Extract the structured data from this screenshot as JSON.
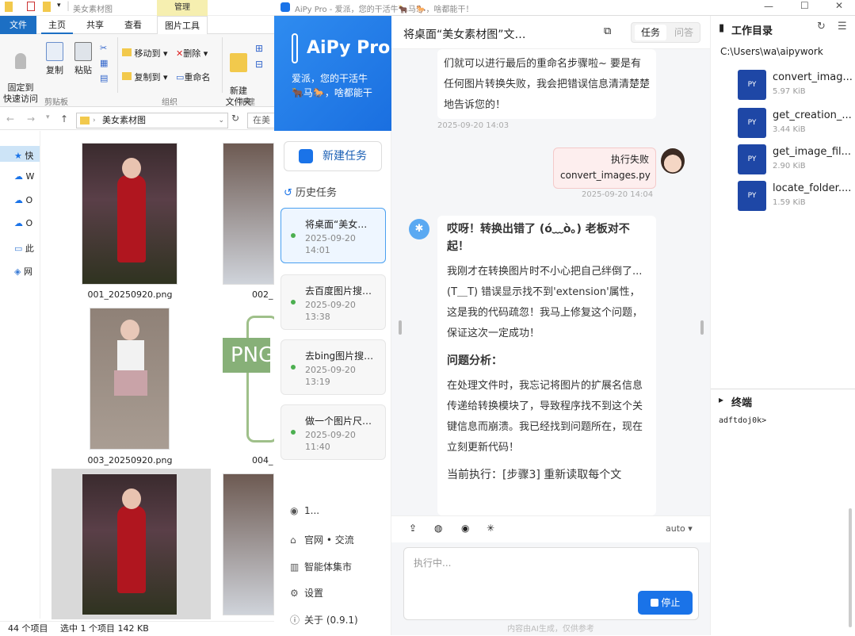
{
  "explorer": {
    "title": "美女素材图",
    "manage_tab": "管理",
    "tabs": [
      "文件",
      "主页",
      "共享",
      "查看",
      "图片工具"
    ],
    "ribbon": {
      "pin": "固定到\n快速访问",
      "copy": "复制",
      "paste": "粘贴",
      "move_to": "移动到",
      "copy_to": "复制到",
      "delete": "删除",
      "rename": "重命名",
      "new_folder": "新建\n文件夹",
      "group_clipboard": "剪贴板",
      "group_organize": "组织",
      "group_new": "新建"
    },
    "address": "美女素材图",
    "search_placeholder": "在美",
    "nav_items": [
      "快",
      "W",
      "O",
      "O",
      "此",
      "网"
    ],
    "files": [
      {
        "name": "001_20250920.png"
      },
      {
        "name": "002_"
      },
      {
        "name": "003_20250920.png"
      },
      {
        "name": "004_"
      }
    ],
    "status_count": "44 个项目",
    "status_selected": "选中 1 个项目  142 KB"
  },
  "aipy": {
    "window_title": "AiPy Pro - 爱派，您的干活牛🐂马🐎，啥都能干！",
    "app_name": "AiPy Pro",
    "slogan": "爱派，您的干活牛🐂马🐎，啥都能干",
    "new_task": "新建任务",
    "history": "历史任务",
    "tasks": [
      {
        "title": "将桌面“美女…",
        "date": "2025-09-20 14:01"
      },
      {
        "title": "去百度图片搜…",
        "date": "2025-09-20 13:38"
      },
      {
        "title": "去bing图片搜…",
        "date": "2025-09-20 13:19"
      },
      {
        "title": "做一个图片尺…",
        "date": "2025-09-20 11:40"
      }
    ],
    "bottom": {
      "user": "1...",
      "site": "官网 • 交流",
      "market": "智能体集市",
      "settings": "设置",
      "about": "关于 (0.9.1)"
    },
    "chat": {
      "title": "将桌面“美女素材图”文…",
      "seg_task": "任务",
      "seg_qa": "问答",
      "prev_text": "们就可以进行最后的重命名步骤啦~ 要是有任何图片转换失败，我会把错误信息清清楚楚地告诉您的！",
      "prev_time": "2025-09-20 14:03",
      "user_msg1": "执行失败",
      "user_msg2": "convert_images.py",
      "user_time": "2025-09-20 14:04",
      "reply_title": "哎呀！转换出错了 (ó﹏ò｡) 老板对不起！",
      "reply_p1": "我刚才在转换图片时不小心把自己绊倒了... (T＿T) 错误显示找不到'extension'属性，这是我的代码疏忽！我马上修复这个问题，保证这次一定成功！",
      "reply_h2": "问题分析：",
      "reply_p2": "在处理文件时，我忘记将图片的扩展名信息传递给转换模块了，导致程序找不到这个关键信息而崩溃。我已经找到问题所在，现在立刻更新代码！",
      "reply_p3": "当前执行：[步骤3] 重新读取每个文",
      "mode": "auto ▾",
      "input_placeholder": "执行中...",
      "stop": "停止",
      "footer": "内容由AI生成，仅供参考"
    },
    "workdir": {
      "title": "工作目录",
      "path": "C:\\Users\\wa\\aipywork",
      "files": [
        {
          "name": "convert_imag...",
          "size": "5.97 KiB"
        },
        {
          "name": "get_creation_...",
          "size": "3.44 KiB"
        },
        {
          "name": "get_image_fil...",
          "size": "2.90 KiB"
        },
        {
          "name": "locate_folder....",
          "size": "1.59 KiB"
        }
      ]
    },
    "terminal": {
      "title": "终端",
      "prompt": "adftdoj0k> "
    }
  },
  "colors": {
    "accent": "#1a73e8",
    "brand_gradient": "#2f8cf0",
    "file_tab": "#1c6fc4",
    "manage": "#f6efb0"
  }
}
